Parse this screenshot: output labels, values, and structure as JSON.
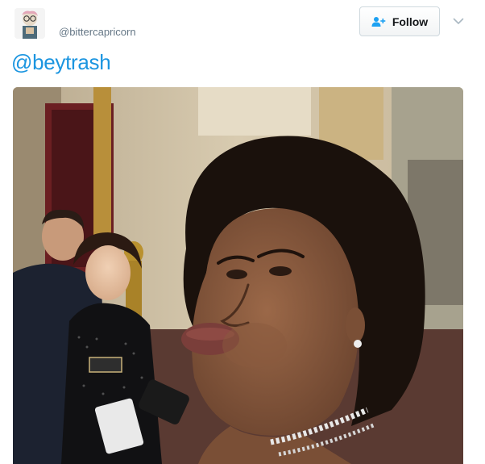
{
  "user": {
    "handle": "@bittercapricorn",
    "avatar_icon": "avatar-illustration"
  },
  "header": {
    "follow_label": "Follow",
    "follow_icon": "add-user-icon",
    "menu_icon": "chevron-down-icon"
  },
  "tweet": {
    "text": "@beytrash"
  },
  "media": {
    "type": "photo",
    "description_icon": "embedded-photo"
  },
  "colors": {
    "link": "#1b95e0",
    "follow_icon": "#1da1f2",
    "handle": "#657786"
  }
}
